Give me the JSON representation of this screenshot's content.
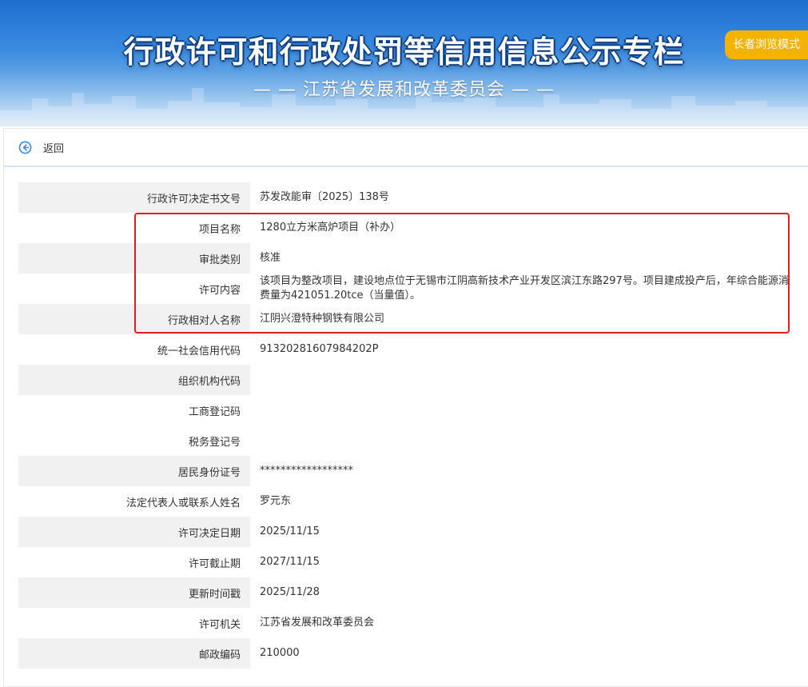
{
  "header": {
    "title": "行政许可和行政处罚等信用信息公示专栏",
    "subtitle": "— — 江苏省发展和改革委员会 — —",
    "elder_mode_label": "长者浏览模式"
  },
  "nav": {
    "back_label": "返回"
  },
  "details": [
    {
      "label": "行政许可决定书文号",
      "value": "苏发改能审〔2025〕138号"
    },
    {
      "label": "项目名称",
      "value": "1280立方米高炉项目（补办）"
    },
    {
      "label": "审批类别",
      "value": "核准"
    },
    {
      "label": "许可内容",
      "value": "该项目为整改项目，建设地点位于无锡市江阴高新技术产业开发区滨江东路297号。项目建成投产后，年综合能源消费量为421051.20tce（当量值）。"
    },
    {
      "label": "行政相对人名称",
      "value": "江阴兴澄特种钢铁有限公司"
    },
    {
      "label": "统一社会信用代码",
      "value": "91320281607984202P"
    },
    {
      "label": "组织机构代码",
      "value": ""
    },
    {
      "label": "工商登记码",
      "value": ""
    },
    {
      "label": "税务登记号",
      "value": ""
    },
    {
      "label": "居民身份证号",
      "value": "******************"
    },
    {
      "label": "法定代表人或联系人姓名",
      "value": "罗元东"
    },
    {
      "label": "许可决定日期",
      "value": "2025/11/15"
    },
    {
      "label": "许可截止期",
      "value": "2027/11/15"
    },
    {
      "label": "更新时间戳",
      "value": "2025/11/28"
    },
    {
      "label": "许可机关",
      "value": "江苏省发展和改革委员会"
    },
    {
      "label": "邮政编码",
      "value": "210000"
    }
  ],
  "colors": {
    "banner_blue": "#1d6fd0",
    "elder_button": "#f3b300",
    "highlight_border": "#e21f1f",
    "row_shade": "#f1f1f1",
    "back_icon": "#2e86de"
  }
}
